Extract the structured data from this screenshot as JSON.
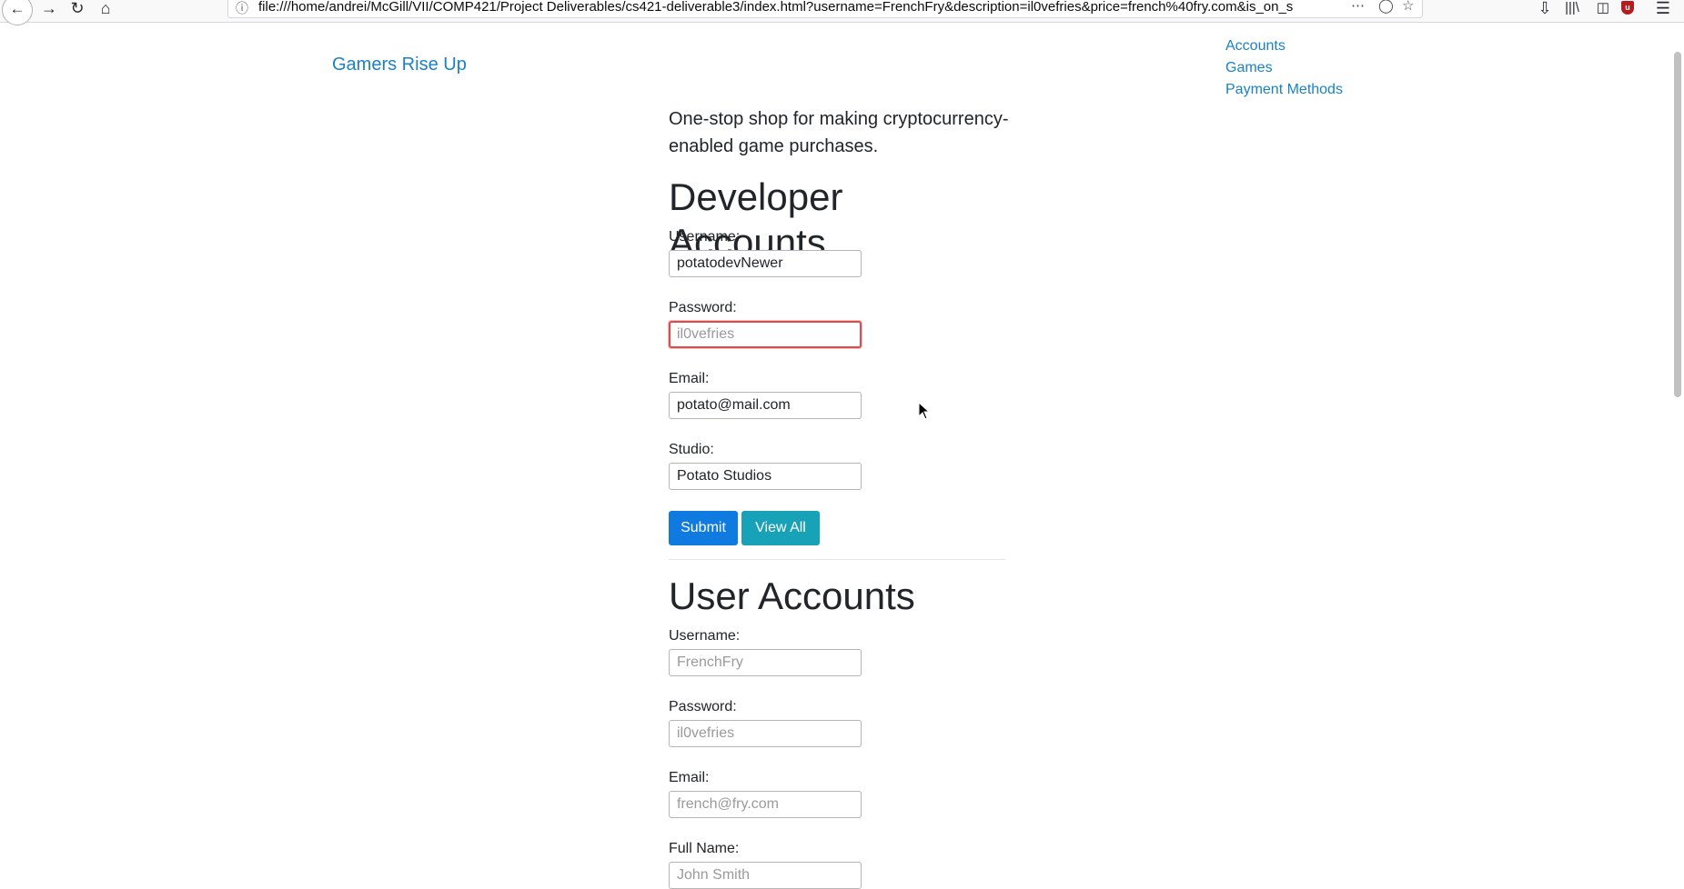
{
  "browser": {
    "url": "file:///home/andrei/McGill/VII/COMP421/Project Deliverables/cs421-deliverable3/index.html?username=FrenchFry&description=il0vefries&price=french%40fry.com&is_on_s",
    "icons": [
      "back-icon",
      "forward-icon",
      "reload-icon",
      "home-icon",
      "info-icon",
      "more-icon",
      "pocket-icon",
      "bookmark-star-icon",
      "download-icon",
      "library-icon",
      "sidebar-icon",
      "ublock-icon",
      "menu-icon"
    ]
  },
  "header": {
    "brand": "Gamers Rise Up",
    "nav": [
      "Accounts",
      "Games",
      "Payment Methods"
    ]
  },
  "main": {
    "tagline": "One-stop shop for making cryptocurrency-enabled game purchases.",
    "developer": {
      "title": "Developer Accounts",
      "username_label": "Username:",
      "username_value": "potatodevNewer",
      "password_label": "Password:",
      "password_placeholder": "il0vefries",
      "email_label": "Email:",
      "email_value": "potato@mail.com",
      "studio_label": "Studio:",
      "studio_value": "Potato Studios",
      "submit": "Submit",
      "view_all": "View All"
    },
    "user": {
      "title": "User Accounts",
      "username_label": "Username:",
      "username_placeholder": "FrenchFry",
      "password_label": "Password:",
      "password_placeholder": "il0vefries",
      "email_label": "Email:",
      "email_placeholder": "french@fry.com",
      "fullname_label": "Full Name:",
      "fullname_placeholder": "John Smith"
    }
  },
  "colors": {
    "link": "#1a82c4",
    "submit": "#0f7be0",
    "view_all": "#17a2b8",
    "invalid_border": "#e04b4b"
  }
}
